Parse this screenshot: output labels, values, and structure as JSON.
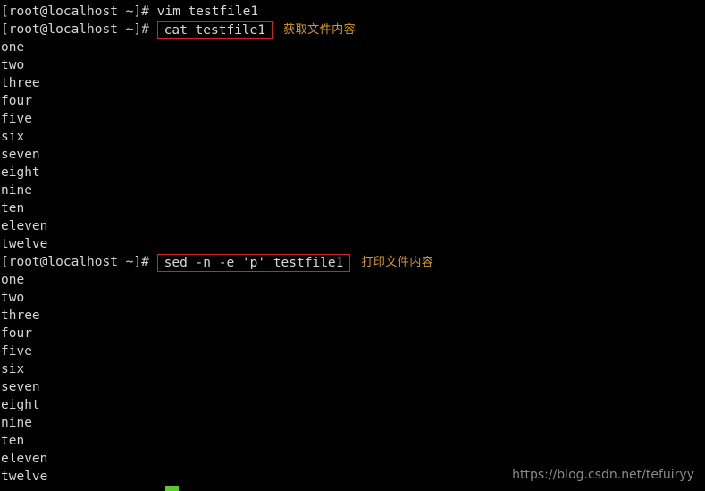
{
  "terminal": {
    "prompt": "[root@localhost ~]# ",
    "colors": {
      "background": "#000000",
      "foreground": "#d6d6d6",
      "annotation_box": "#d42121",
      "annotation_text": "#d79a17",
      "cursor": "#5ec92b",
      "watermark": "#8a8a8a"
    },
    "commands": [
      {
        "text": "vim testfile1",
        "boxed": false,
        "note": ""
      },
      {
        "text": "cat testfile1",
        "boxed": true,
        "note": "获取文件内容"
      },
      {
        "text": "sed -n -e 'p' testfile1",
        "boxed": true,
        "note": "打印文件内容"
      }
    ],
    "file_contents": [
      "one",
      "two",
      "three",
      "four",
      "five",
      "six",
      "seven",
      "eight",
      "nine",
      "ten",
      "eleven",
      "twelve"
    ],
    "watermark": "https://blog.csdn.net/tefuiryy"
  }
}
